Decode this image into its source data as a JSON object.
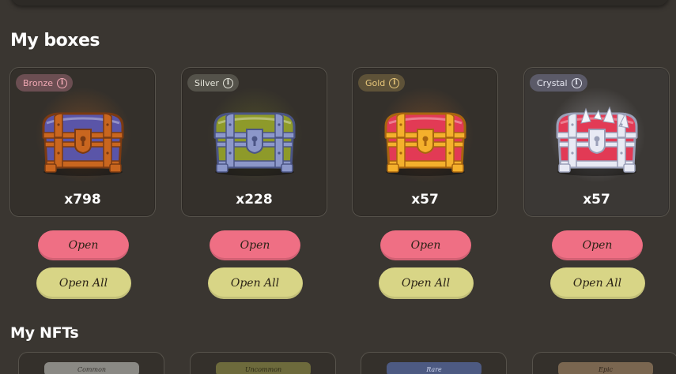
{
  "sections": {
    "boxes_title": "My boxes",
    "nfts_title": "My NFTs"
  },
  "boxes": [
    {
      "tier": "Bronze",
      "count": "x798",
      "open_label": "Open",
      "open_all_label": "Open All",
      "badge_bg": "#6b4e52",
      "badge_fg": "#f2a9b4",
      "lid_color": "#5a55a8",
      "trim_color": "#c9661f",
      "trim_dark": "#7a3a12",
      "glow": "rgba(170,95,35,0.45)"
    },
    {
      "tier": "Silver",
      "count": "x228",
      "open_label": "Open",
      "open_all_label": "Open All",
      "badge_bg": "#54524a",
      "badge_fg": "#e6e6dc",
      "lid_color": "#8e9a2a",
      "trim_color": "#8c97c9",
      "trim_dark": "#4b5585",
      "glow": "rgba(130,135,40,0.35)"
    },
    {
      "tier": "Gold",
      "count": "x57",
      "open_label": "Open",
      "open_all_label": "Open All",
      "badge_bg": "#5e5238",
      "badge_fg": "#e8c77a",
      "lid_color": "#e23a55",
      "trim_color": "#f4b02c",
      "trim_dark": "#a8650f",
      "glow": "rgba(200,110,40,0.35)"
    },
    {
      "tier": "Crystal",
      "count": "x57",
      "open_label": "Open",
      "open_all_label": "Open All",
      "badge_bg": "#5b5a68",
      "badge_fg": "#e7e8f2",
      "lid_color": "#e23a55",
      "trim_color": "#e8eaf4",
      "trim_dark": "#9aa0b8",
      "glow": "rgba(235,235,245,0.35)"
    }
  ],
  "nfts": [
    {
      "rarity": "Common",
      "tag_color": "#8a8984",
      "text_color": "#3a3733"
    },
    {
      "rarity": "Uncommon",
      "tag_color": "#6d6a3c",
      "text_color": "#2c2a16"
    },
    {
      "rarity": "Rare",
      "tag_color": "#4d5a82",
      "text_color": "#cfd6ee"
    },
    {
      "rarity": "Epic",
      "tag_color": "#7a6650",
      "text_color": "#2e241a"
    }
  ]
}
